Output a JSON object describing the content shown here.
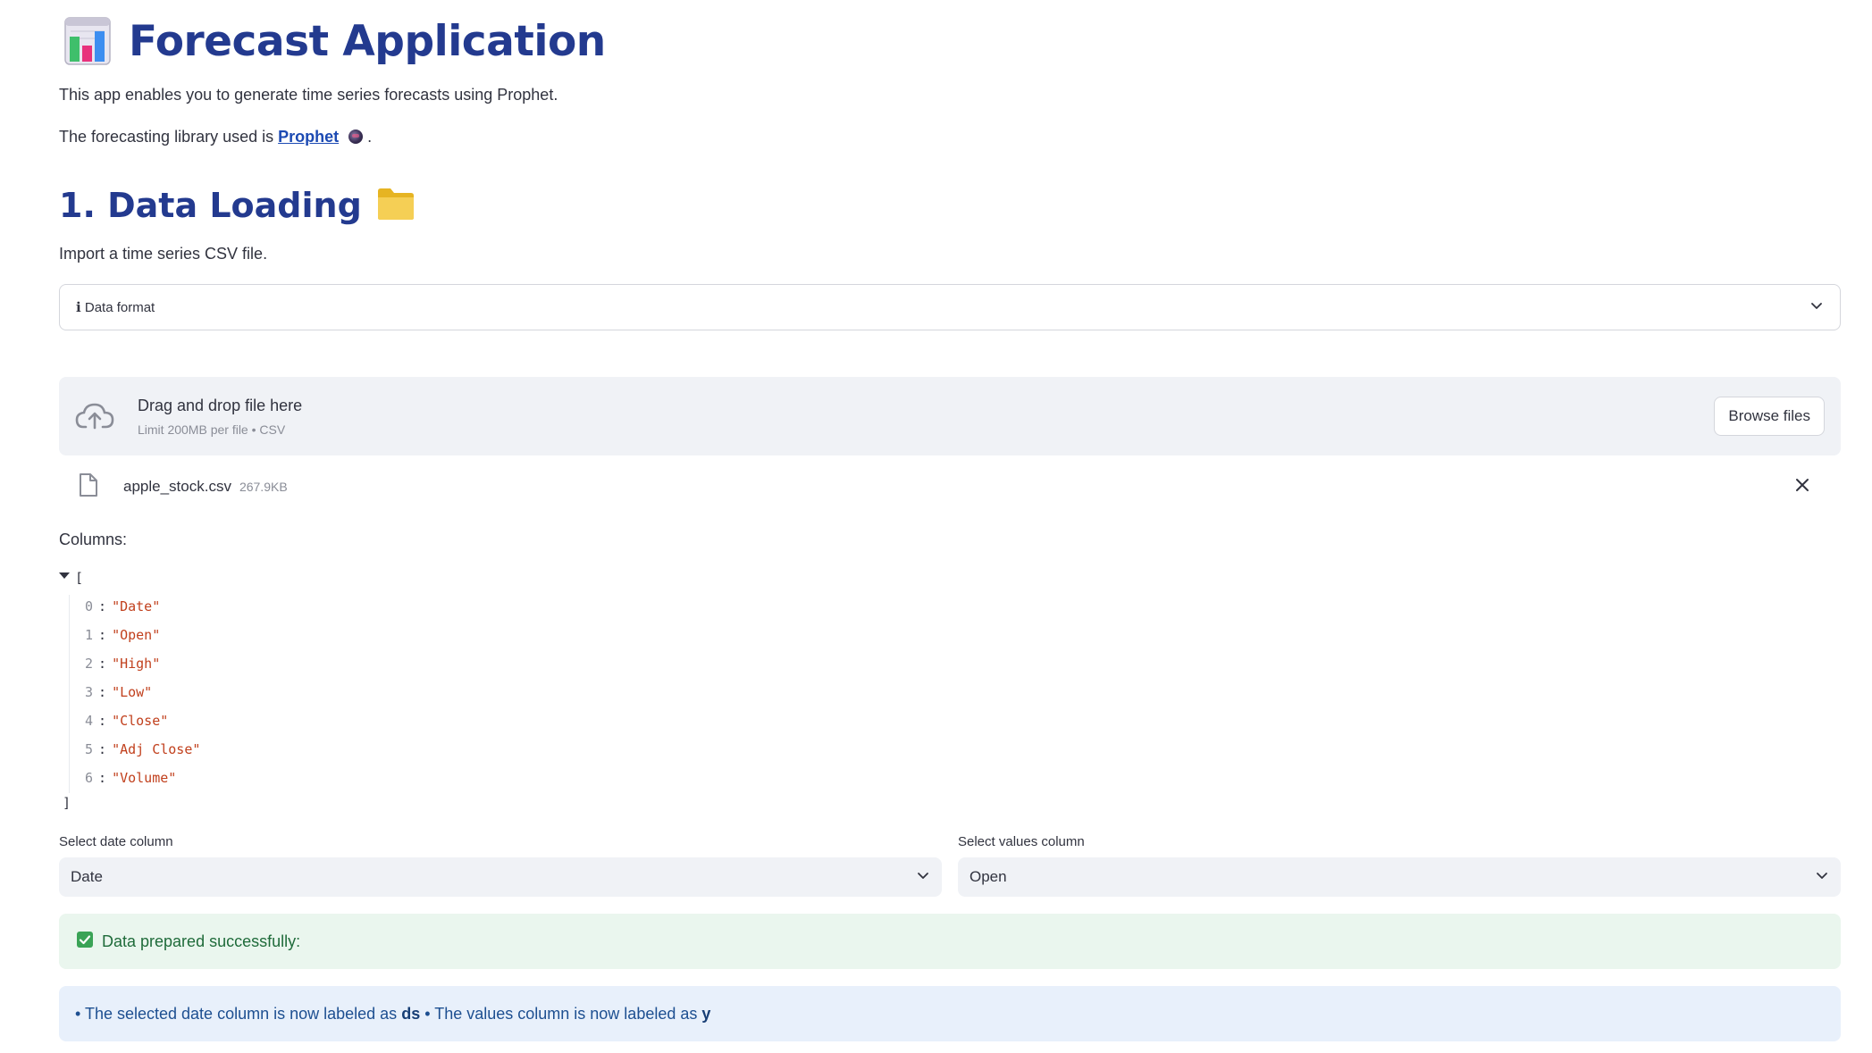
{
  "header": {
    "title": "Forecast Application",
    "icon": "bar-chart-icon"
  },
  "intro": {
    "description": "This app enables you to generate time series forecasts using Prophet.",
    "library_prefix": "The forecasting library used is",
    "library_link": "Prophet",
    "library_suffix": "."
  },
  "data_loading": {
    "title": "1. Data Loading",
    "icon": "folder-icon",
    "instruction": "Import a time series CSV file.",
    "expander_label": "ℹ Data format"
  },
  "uploader": {
    "drop_text": "Drag and drop file here",
    "limit_text": "Limit 200MB per file • CSV",
    "browse_label": "Browse files"
  },
  "file": {
    "name": "apple_stock.csv",
    "size": "267.9KB"
  },
  "columns": {
    "label": "Columns:",
    "open_bracket": "[",
    "close_bracket": "]",
    "items": [
      {
        "index": "0",
        "value": "\"Date\""
      },
      {
        "index": "1",
        "value": "\"Open\""
      },
      {
        "index": "2",
        "value": "\"High\""
      },
      {
        "index": "3",
        "value": "\"Low\""
      },
      {
        "index": "4",
        "value": "\"Close\""
      },
      {
        "index": "5",
        "value": "\"Adj Close\""
      },
      {
        "index": "6",
        "value": "\"Volume\""
      }
    ]
  },
  "selects": {
    "date_label": "Select date column",
    "date_value": "Date",
    "values_label": "Select values column",
    "values_value": "Open"
  },
  "success": {
    "text": "Data prepared successfully:"
  },
  "info": {
    "part1": "• The selected date column is now labeled as",
    "ds": "ds",
    "part2": "• The values column is now labeled as",
    "y": "y"
  },
  "colors": {
    "title": "#233a8f",
    "link": "#1c4ab3",
    "json_value": "#c1401d",
    "success_bg": "#eaf6ee",
    "success_text": "#1f6b3a",
    "info_bg": "#e8f0fb",
    "info_text": "#1d4f91"
  }
}
